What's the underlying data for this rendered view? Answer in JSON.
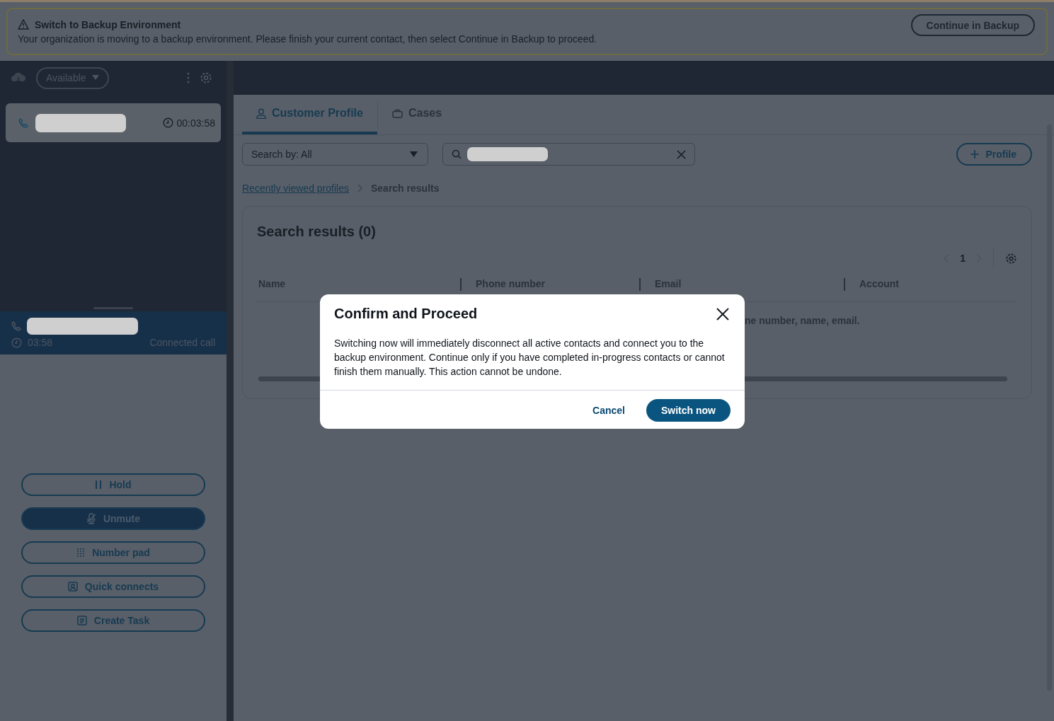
{
  "banner": {
    "title": "Switch to Backup Environment",
    "message": "Your organization is moving to a backup environment. Please finish your current contact, then select Continue in Backup to proceed.",
    "button": "Continue in Backup"
  },
  "agent": {
    "status": "Available",
    "active_timer": "00:03:58",
    "connected_timer": "03:58",
    "connected_label": "Connected call",
    "controls": [
      {
        "label": "Hold",
        "kind": "hold",
        "on": false
      },
      {
        "label": "Unmute",
        "kind": "mute",
        "on": true
      },
      {
        "label": "Number pad",
        "kind": "numpad",
        "on": false
      },
      {
        "label": "Quick connects",
        "kind": "quick",
        "on": false
      },
      {
        "label": "Create Task",
        "kind": "task",
        "on": false
      }
    ]
  },
  "tabs": [
    {
      "label": "Customer Profile",
      "kind": "profile",
      "selected": true
    },
    {
      "label": "Cases",
      "kind": "cases",
      "selected": false
    }
  ],
  "search": {
    "filter": "Search by: All"
  },
  "add_button": "Profile",
  "breadcrumb": [
    {
      "label": "Recently viewed profiles",
      "link": true
    },
    {
      "label": "Search results",
      "link": false
    }
  ],
  "results": {
    "title": "Search results (0)",
    "page": "1",
    "columns": [
      "Name",
      "Phone number",
      "Email",
      "Account"
    ],
    "empty_text": "ne number, name, email."
  },
  "dialog": {
    "title": "Confirm and Proceed",
    "body": "Switching now will immediately disconnect all active contacts and connect you to the backup environment. Continue only if you have completed in-progress contacts or cannot finish them manually. This action cannot be undone.",
    "buttons": [
      {
        "label": "Cancel",
        "kind": "link"
      },
      {
        "label": "Switch now",
        "kind": "primary"
      }
    ]
  }
}
